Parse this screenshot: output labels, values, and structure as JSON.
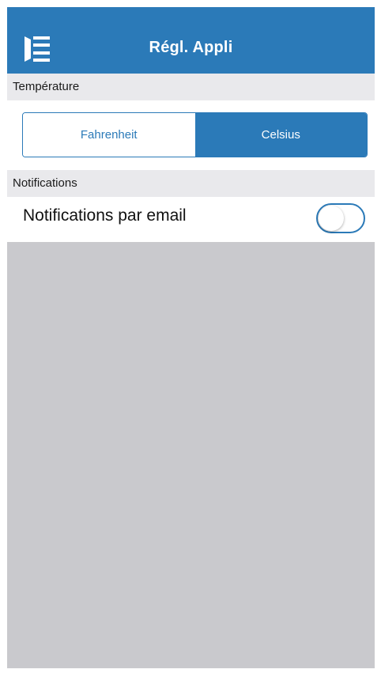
{
  "header": {
    "title": "Régl. Appli",
    "menu_icon": "menu-icon",
    "color": "#2b7ab8"
  },
  "temperature": {
    "section_label": "Température",
    "options": [
      "Fahrenheit",
      "Celsius"
    ],
    "selected": "Celsius"
  },
  "notifications": {
    "section_label": "Notifications",
    "email_label": "Notifications par email",
    "email_enabled": false
  },
  "colors": {
    "accent": "#2b7ab8",
    "background": "#c9c9cd",
    "section_header": "#e9e9ec"
  }
}
